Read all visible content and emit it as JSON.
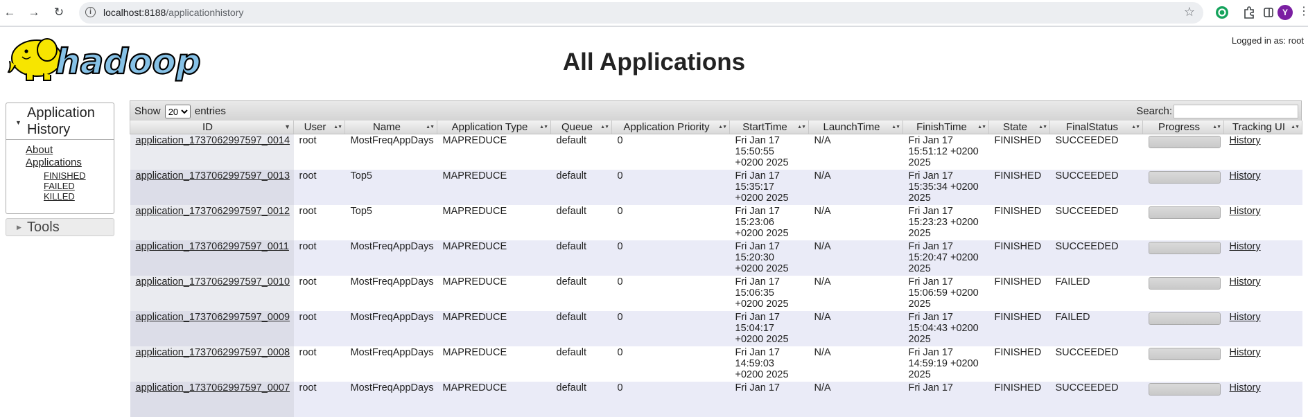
{
  "browser": {
    "url_host": "localhost:8188",
    "url_path": "/applicationhistory",
    "avatar_letter": "Y"
  },
  "header": {
    "title": "All Applications",
    "logged_in": "Logged in as: root",
    "logo_text": "hadoop"
  },
  "sidebar": {
    "section_title": "Application History",
    "about": "About",
    "applications": "Applications",
    "filters": [
      "FINISHED",
      "FAILED",
      "KILLED"
    ],
    "tools": "Tools"
  },
  "table": {
    "show_label": "Show",
    "entries_label": "entries",
    "page_size": "20",
    "search_label": "Search:",
    "columns": [
      "ID",
      "User",
      "Name",
      "Application Type",
      "Queue",
      "Application Priority",
      "StartTime",
      "LaunchTime",
      "FinishTime",
      "State",
      "FinalStatus",
      "Progress",
      "Tracking UI"
    ],
    "rows": [
      {
        "id": "application_1737062997597_0014",
        "user": "root",
        "name": "MostFreqAppDays",
        "type": "MAPREDUCE",
        "queue": "default",
        "priority": "0",
        "start": "Fri Jan 17 15:50:55 +0200 2025",
        "launch": "N/A",
        "finish": "Fri Jan 17 15:51:12 +0200 2025",
        "state": "FINISHED",
        "final": "SUCCEEDED",
        "progress": 100,
        "tracking": "History"
      },
      {
        "id": "application_1737062997597_0013",
        "user": "root",
        "name": "Top5",
        "type": "MAPREDUCE",
        "queue": "default",
        "priority": "0",
        "start": "Fri Jan 17 15:35:17 +0200 2025",
        "launch": "N/A",
        "finish": "Fri Jan 17 15:35:34 +0200 2025",
        "state": "FINISHED",
        "final": "SUCCEEDED",
        "progress": 100,
        "tracking": "History"
      },
      {
        "id": "application_1737062997597_0012",
        "user": "root",
        "name": "Top5",
        "type": "MAPREDUCE",
        "queue": "default",
        "priority": "0",
        "start": "Fri Jan 17 15:23:06 +0200 2025",
        "launch": "N/A",
        "finish": "Fri Jan 17 15:23:23 +0200 2025",
        "state": "FINISHED",
        "final": "SUCCEEDED",
        "progress": 100,
        "tracking": "History"
      },
      {
        "id": "application_1737062997597_0011",
        "user": "root",
        "name": "MostFreqAppDays",
        "type": "MAPREDUCE",
        "queue": "default",
        "priority": "0",
        "start": "Fri Jan 17 15:20:30 +0200 2025",
        "launch": "N/A",
        "finish": "Fri Jan 17 15:20:47 +0200 2025",
        "state": "FINISHED",
        "final": "SUCCEEDED",
        "progress": 100,
        "tracking": "History"
      },
      {
        "id": "application_1737062997597_0010",
        "user": "root",
        "name": "MostFreqAppDays",
        "type": "MAPREDUCE",
        "queue": "default",
        "priority": "0",
        "start": "Fri Jan 17 15:06:35 +0200 2025",
        "launch": "N/A",
        "finish": "Fri Jan 17 15:06:59 +0200 2025",
        "state": "FINISHED",
        "final": "FAILED",
        "progress": 100,
        "tracking": "History"
      },
      {
        "id": "application_1737062997597_0009",
        "user": "root",
        "name": "MostFreqAppDays",
        "type": "MAPREDUCE",
        "queue": "default",
        "priority": "0",
        "start": "Fri Jan 17 15:04:17 +0200 2025",
        "launch": "N/A",
        "finish": "Fri Jan 17 15:04:43 +0200 2025",
        "state": "FINISHED",
        "final": "FAILED",
        "progress": 100,
        "tracking": "History"
      },
      {
        "id": "application_1737062997597_0008",
        "user": "root",
        "name": "MostFreqAppDays",
        "type": "MAPREDUCE",
        "queue": "default",
        "priority": "0",
        "start": "Fri Jan 17 14:59:03 +0200 2025",
        "launch": "N/A",
        "finish": "Fri Jan 17 14:59:19 +0200 2025",
        "state": "FINISHED",
        "final": "SUCCEEDED",
        "progress": 100,
        "tracking": "History"
      },
      {
        "id": "application_1737062997597_0007",
        "user": "root",
        "name": "MostFreqAppDays",
        "type": "MAPREDUCE",
        "queue": "default",
        "priority": "0",
        "start": "Fri Jan 17",
        "launch": "N/A",
        "finish": "Fri Jan 17",
        "state": "FINISHED",
        "final": "SUCCEEDED",
        "progress": 100,
        "tracking": "History"
      }
    ]
  }
}
